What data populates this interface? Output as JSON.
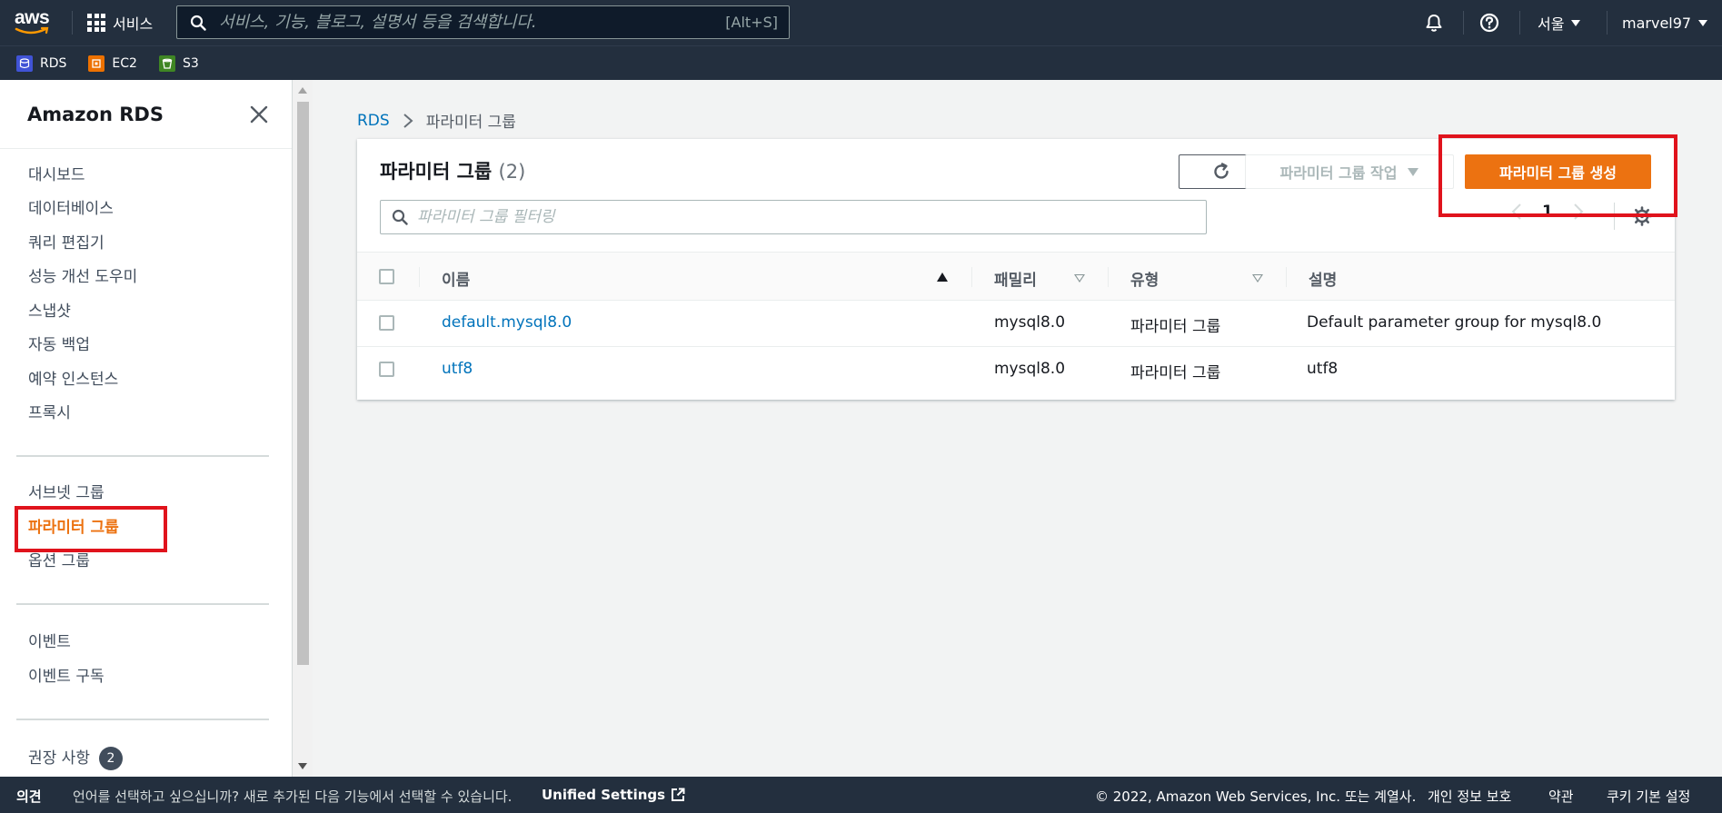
{
  "topnav": {
    "logo_text": "aws",
    "services_label": "서비스",
    "search_placeholder": "서비스, 기능, 블로그, 설명서 등을 검색합니다.",
    "search_shortcut": "[Alt+S]",
    "region_label": "서울",
    "account_label": "marvel97",
    "icons": {
      "bell": "bell-icon",
      "help": "help-circle-icon",
      "grid": "grid-icon",
      "search": "search-icon"
    }
  },
  "favorites": [
    {
      "label": "RDS",
      "color": "#4053d6"
    },
    {
      "label": "EC2",
      "color": "#ed7100"
    },
    {
      "label": "S3",
      "color": "#3f8624"
    }
  ],
  "sidebar": {
    "title": "Amazon RDS",
    "group1": [
      "대시보드",
      "데이터베이스",
      "쿼리 편집기",
      "성능 개선 도우미",
      "스냅샷",
      "자동 백업",
      "예약 인스턴스",
      "프록시"
    ],
    "group2": [
      "서브넷 그룹",
      "파라미터 그룹",
      "옵션 그룹"
    ],
    "group3": [
      "이벤트",
      "이벤트 구독"
    ],
    "group4_label": "권장 사항",
    "group4_badge": "2",
    "active_item": "파라미터 그룹"
  },
  "breadcrumb": {
    "root": "RDS",
    "current": "파라미터 그룹"
  },
  "panel": {
    "title": "파라미터 그룹",
    "count": "(2)",
    "actions_label": "파라미터 그룹 작업",
    "create_label": "파라미터 그룹 생성",
    "filter_placeholder": "파라미터 그룹 필터링",
    "page_number": "1"
  },
  "table": {
    "columns": [
      "이름",
      "패밀리",
      "유형",
      "설명"
    ],
    "rows": [
      {
        "name": "default.mysql8.0",
        "family": "mysql8.0",
        "type": "파라미터 그룹",
        "description": "Default parameter group for mysql8.0"
      },
      {
        "name": "utf8",
        "family": "mysql8.0",
        "type": "파라미터 그룹",
        "description": "utf8"
      }
    ]
  },
  "footer": {
    "feedback": "의견",
    "language_prompt": "언어를 선택하고 싶으십니까? 새로 추가된 다음 기능에서 선택할 수 있습니다.",
    "unified_settings": "Unified Settings",
    "copyright": "© 2022, Amazon Web Services, Inc. 또는 계열사.",
    "privacy": "개인 정보 보호",
    "terms": "약관",
    "cookies": "쿠키 기본 설정"
  },
  "colors": {
    "nav_bg": "#232f3e",
    "accent": "#ec7211",
    "link": "#0073bb",
    "highlight": "#e0131c"
  }
}
